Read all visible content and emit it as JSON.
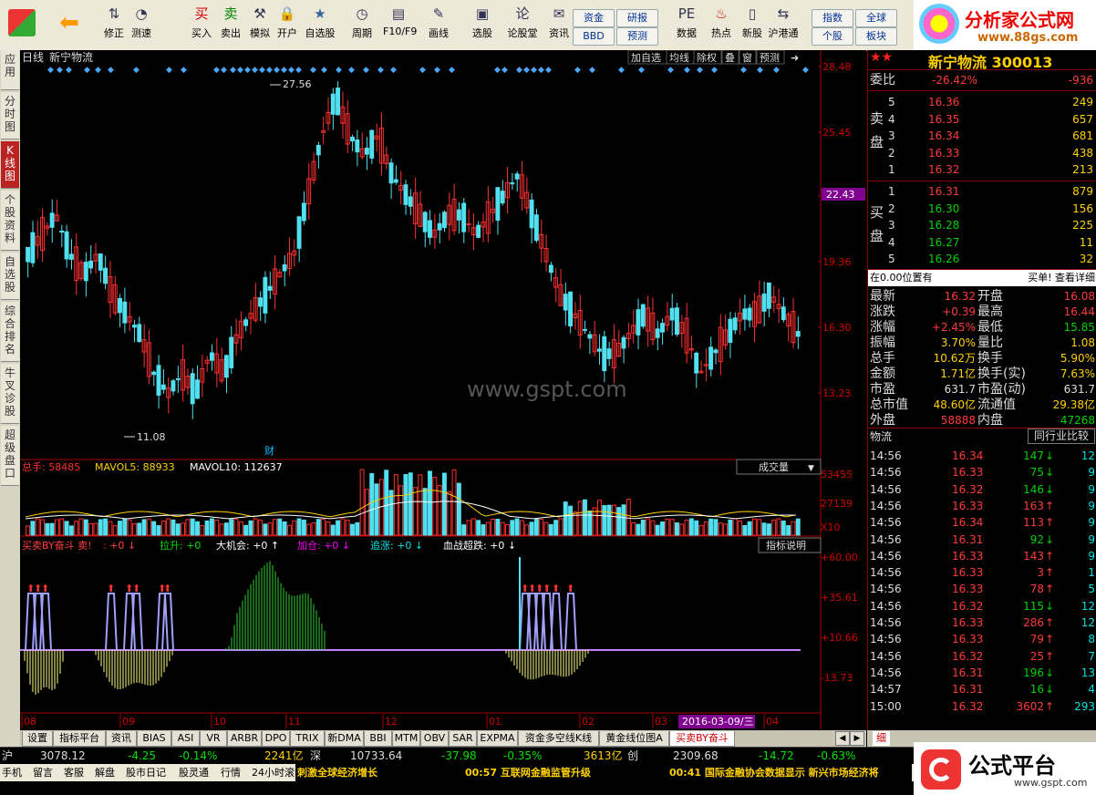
{
  "toolbar": {
    "buttons": [
      {
        "label": "修正",
        "icon": "up-down-arrows-icon"
      },
      {
        "label": "测速",
        "icon": "speedometer-icon"
      },
      {
        "label": "买入",
        "icon": "buy-icon",
        "glyph": "买"
      },
      {
        "label": "卖出",
        "icon": "sell-icon",
        "glyph": "卖"
      },
      {
        "label": "模拟",
        "icon": "hammer-icon"
      },
      {
        "label": "开户",
        "icon": "lock-icon"
      },
      {
        "label": "自选股",
        "icon": "star-icon"
      },
      {
        "label": "周期",
        "icon": "clock-icon"
      },
      {
        "label": "F10/F9",
        "icon": "f10-icon"
      },
      {
        "label": "画线",
        "icon": "pencil-icon"
      },
      {
        "label": "选股",
        "icon": "screen-icon"
      },
      {
        "label": "论股堂",
        "icon": "forum-icon",
        "glyph": "论"
      },
      {
        "label": "资讯",
        "icon": "news-icon"
      },
      {
        "label": "数据",
        "icon": "pe-icon",
        "glyph": "PE"
      },
      {
        "label": "热点",
        "icon": "hot-icon"
      },
      {
        "label": "新股",
        "icon": "ipo-icon"
      },
      {
        "label": "沪港通",
        "icon": "hk-connect-icon"
      }
    ],
    "small": [
      "资金",
      "研报",
      "BBD",
      "预测",
      "指数",
      "全球",
      "个股",
      "板块"
    ]
  },
  "logo": {
    "text": "分析家公式网",
    "url": "www.88gs.com"
  },
  "sidetabs": [
    "应用",
    "分时图",
    "K线图",
    "个股资料",
    "自选股",
    "综合排名",
    "牛叉诊股",
    "超级盘口"
  ],
  "chart": {
    "period": "日线",
    "name": "新宁物流",
    "menu": [
      "加自选",
      "均线",
      "除权",
      "叠",
      "窗",
      "预测"
    ],
    "price_labels": [
      "28.48",
      "25.45",
      "22.43",
      "19.36",
      "16.30",
      "13.23"
    ],
    "current_price_tag": "22.43",
    "hi_label": "27.56",
    "lo_label": "11.08",
    "fin_label": "财",
    "watermark": "www.gspt.com",
    "vol_header": {
      "total": "总手: 58485",
      "mavol5": "MAVOL5: 88933",
      "mavol10": "MAVOL10: 112637"
    },
    "vol_dropdown": "成交量",
    "vol_labels": [
      "53455",
      "27139",
      "X10"
    ],
    "ind_header": [
      {
        "t": "买卖BY奋斗 卖!",
        "c": "#ff4040"
      },
      {
        "t": ": +0 ↓",
        "c": "#ff4040"
      },
      {
        "t": "拉升: +0",
        "c": "#00e000"
      },
      {
        "t": "大机会: +0 ↑",
        "c": "#fff"
      },
      {
        "t": "加仓: +0 ↓",
        "c": "#ff00ff"
      },
      {
        "t": "追涨: +0 ↓",
        "c": "#00e0e0"
      },
      {
        "t": "血战超跌: +0 ↓",
        "c": "#fff"
      }
    ],
    "ind_btn": "指标说明",
    "ind_labels": [
      "+60.00",
      "+35.61",
      "+10.66",
      "-13.73"
    ],
    "months": [
      "08",
      "09",
      "10",
      "11",
      "12",
      "01",
      "02",
      "03",
      "04"
    ],
    "date_tag": "2016-03-09/三"
  },
  "chart_data": {
    "type": "candlestick",
    "title": "新宁物流 日线",
    "ylim": [
      10,
      28.48
    ],
    "yticks": [
      28.48,
      25.45,
      22.43,
      19.36,
      16.3,
      13.23
    ],
    "high": 27.56,
    "low": 11.08,
    "x_months": [
      "08",
      "09",
      "10",
      "11",
      "12",
      "01",
      "02",
      "03",
      "04"
    ],
    "close_approx": [
      19,
      20,
      21,
      19,
      18,
      19,
      17,
      16,
      15,
      13,
      12,
      13,
      12,
      14,
      13,
      15,
      16,
      17,
      18,
      19,
      22,
      25,
      27,
      25,
      24,
      25,
      23,
      22,
      21,
      20,
      21,
      21,
      20,
      21,
      22,
      23,
      21,
      19,
      17,
      16,
      15,
      14,
      14,
      15,
      16,
      15,
      16,
      15,
      13,
      14,
      15,
      16,
      16,
      17,
      16,
      15
    ],
    "volume_ylim": [
      0,
      53455
    ],
    "volume_ticks": [
      53455,
      27139
    ],
    "volume_unit": "X10",
    "volume_last": 58485,
    "mavol5": 88933,
    "mavol10": 112637,
    "indicator_ylim": [
      -13.73,
      60.0
    ],
    "indicator_ticks": [
      60.0,
      35.61,
      10.66,
      -13.73
    ]
  },
  "panel": {
    "title": "新宁物流 300013",
    "webi": {
      "label": "委比",
      "pct": "-26.42%",
      "val": "-936"
    },
    "sell": [
      [
        "5",
        "16.36",
        "249"
      ],
      [
        "4",
        "16.35",
        "657"
      ],
      [
        "3",
        "16.34",
        "681"
      ],
      [
        "2",
        "16.33",
        "438"
      ],
      [
        "1",
        "16.32",
        "213"
      ]
    ],
    "buy": [
      [
        "1",
        "16.31",
        "879"
      ],
      [
        "2",
        "16.30",
        "156"
      ],
      [
        "3",
        "16.28",
        "225"
      ],
      [
        "4",
        "16.27",
        "11"
      ],
      [
        "5",
        "16.26",
        "32"
      ]
    ],
    "sell_label": "卖盘",
    "buy_label": "买盘",
    "pos": "在0.00位置有",
    "pos_right": "买单! 查看详细",
    "stats": [
      [
        "最新",
        "16.32",
        "r",
        "开盘",
        "16.08",
        "r"
      ],
      [
        "涨跌",
        "+0.39",
        "r",
        "最高",
        "16.44",
        "r"
      ],
      [
        "涨幅",
        "+2.45%",
        "r",
        "最低",
        "15.85",
        "g"
      ],
      [
        "振幅",
        "3.70%",
        "y",
        "量比",
        "1.08",
        "y"
      ],
      [
        "总手",
        "10.62万",
        "y",
        "换手",
        "5.90%",
        "y"
      ],
      [
        "金额",
        "1.71亿",
        "y",
        "换手(实)",
        "7.63%",
        "y"
      ],
      [
        "市盈",
        "631.7",
        "w",
        "市盈(动)",
        "631.7",
        "w"
      ],
      [
        "总市值",
        "48.60亿",
        "y",
        "流通值",
        "29.38亿",
        "y"
      ],
      [
        "外盘",
        "58888",
        "r",
        "内盘",
        "47268",
        "g"
      ]
    ],
    "ticks_header": "物流",
    "ticks_btn": "同行业比较",
    "ticks": [
      [
        "14:56",
        "16.34",
        "147",
        "↓",
        "12"
      ],
      [
        "14:56",
        "16.33",
        "75",
        "↓",
        "9"
      ],
      [
        "14:56",
        "16.32",
        "146",
        "↓",
        "9"
      ],
      [
        "14:56",
        "16.33",
        "163",
        "↑",
        "9"
      ],
      [
        "14:56",
        "16.34",
        "113",
        "↑",
        "9"
      ],
      [
        "14:56",
        "16.31",
        "92",
        "↓",
        "9"
      ],
      [
        "14:56",
        "16.33",
        "143",
        "↑",
        "9"
      ],
      [
        "14:56",
        "16.33",
        "3",
        "↑",
        "1"
      ],
      [
        "14:56",
        "16.33",
        "78",
        "↑",
        "5"
      ],
      [
        "14:56",
        "16.32",
        "115",
        "↓",
        "12"
      ],
      [
        "14:56",
        "16.33",
        "286",
        "↑",
        "12"
      ],
      [
        "14:56",
        "16.33",
        "79",
        "↑",
        "8"
      ],
      [
        "14:56",
        "16.32",
        "25",
        "↑",
        "7"
      ],
      [
        "14:56",
        "16.31",
        "196",
        "↓",
        "13"
      ],
      [
        "14:57",
        "16.31",
        "16",
        "↓",
        "4"
      ],
      [
        "15:00",
        "16.32",
        "3602",
        "↑",
        "293"
      ]
    ]
  },
  "btabs": [
    "设置",
    "指标平台",
    "资讯",
    "BIAS",
    "ASI",
    "VR",
    "ARBR",
    "DPO",
    "TRIX",
    "新DMA",
    "BBI",
    "MTM",
    "OBV",
    "SAR",
    "EXPMA",
    "资金多空线K线",
    "黄金线位图A",
    "买卖BY奋斗"
  ],
  "status1": [
    {
      "t": "沪",
      "c": "#ddd"
    },
    {
      "t": "3078.12",
      "c": "#ddd"
    },
    {
      "t": "-4.25",
      "c": "#00e000"
    },
    {
      "t": "-0.14%",
      "c": "#00e000"
    },
    {
      "t": "2241亿",
      "c": "#ffd000"
    },
    {
      "t": "深",
      "c": "#ddd"
    },
    {
      "t": "10733.64",
      "c": "#ddd"
    },
    {
      "t": "-37.98",
      "c": "#00e000"
    },
    {
      "t": "-0.35%",
      "c": "#00e000"
    },
    {
      "t": "3613亿",
      "c": "#ffd000"
    },
    {
      "t": "创",
      "c": "#ddd"
    },
    {
      "t": "2309.68",
      "c": "#ddd"
    },
    {
      "t": "-14.72",
      "c": "#00e000"
    },
    {
      "t": "-0.63%",
      "c": "#00e000"
    }
  ],
  "status2": [
    "手机",
    "留言",
    "客服",
    "解盘",
    "股市日记",
    "股灵通",
    "行情",
    "24小时滚动"
  ],
  "news": [
    {
      "t": "刺激全球经济增长",
      "c": "#ffd000"
    },
    {
      "t": "00:57 互联网金融监管升级",
      "c": "#ffd000"
    },
    {
      "t": "00:41 国际金融协会数据显示 新兴市场经济将",
      "c": "#ffd000"
    }
  ],
  "gongshi": {
    "text": "公式平台",
    "url": "www.gspt.com"
  }
}
